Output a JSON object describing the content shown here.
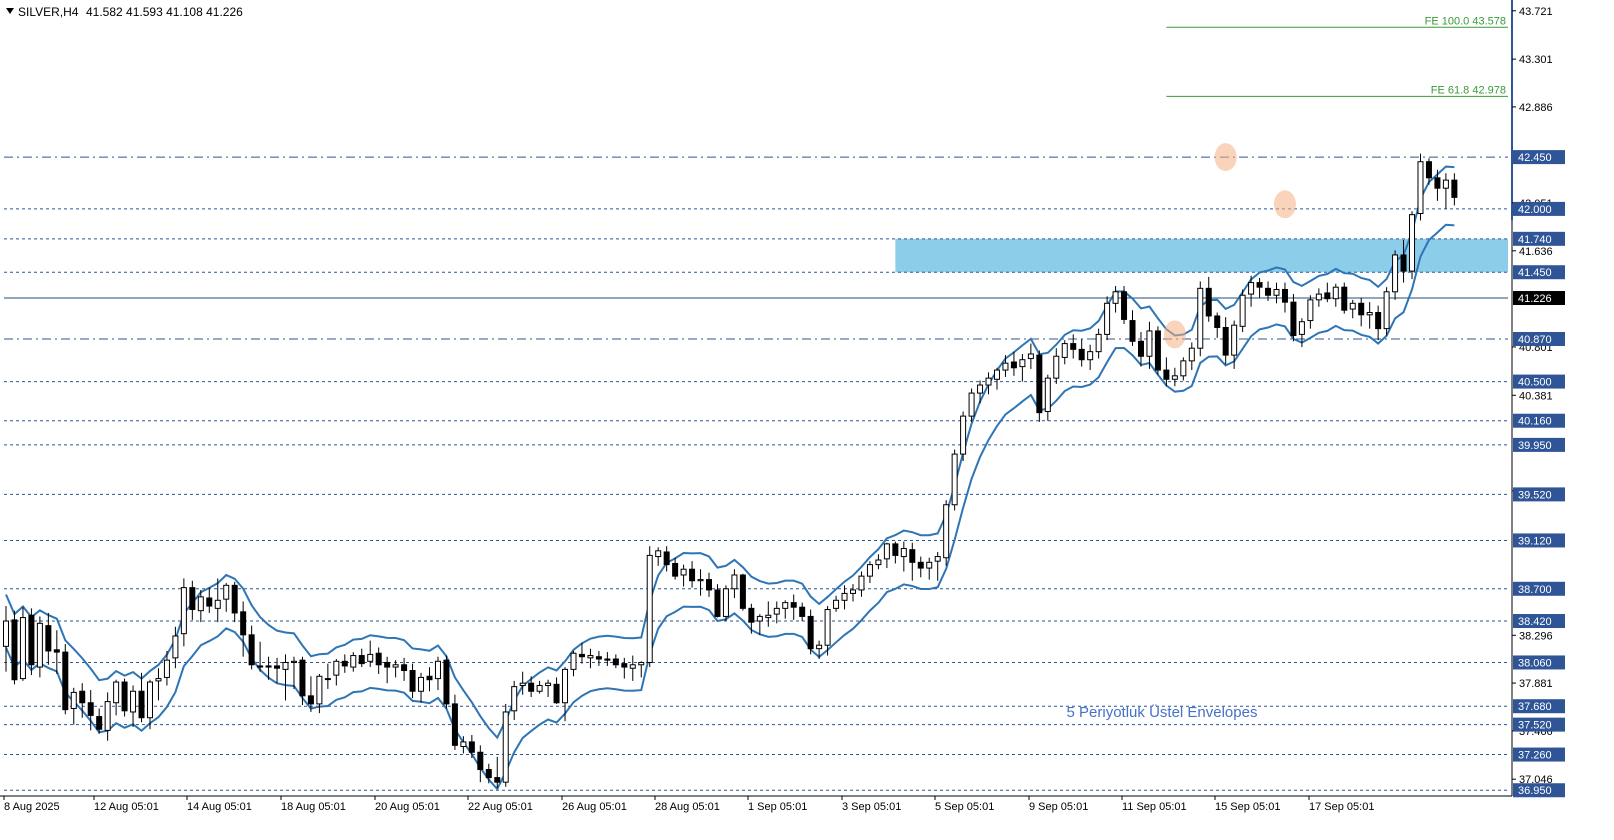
{
  "header": {
    "symbol": "SILVER,H4",
    "ohlc": "41.582 41.593 41.108 41.226"
  },
  "annotation": "5 Periyotluk Üstel Envelopes",
  "colors": {
    "band": "#2e75b6",
    "hline": "#2f5597",
    "zone": "#7fc8e8",
    "fib": "#3a9a3a",
    "fib_text": "#3a9a3a",
    "label_bg": "#2f5597",
    "highlight": "#f4b183",
    "annotation": "#4472c4"
  },
  "chart_data": {
    "type": "candlestick",
    "ylim": [
      36.9,
      43.78
    ],
    "x_tick_labels": [
      "8 Aug 2025",
      "12 Aug 05:01",
      "14 Aug 05:01",
      "18 Aug 05:01",
      "20 Aug 05:01",
      "22 Aug 05:01",
      "26 Aug 05:01",
      "28 Aug 05:01",
      "1 Sep 05:01",
      "3 Sep 05:01",
      "5 Sep 05:01",
      "9 Sep 05:01",
      "11 Sep 05:01",
      "15 Sep 05:01",
      "17 Sep 05:01"
    ],
    "y_tick_labels": [
      "43.721",
      "43.301",
      "42.886",
      "42.051",
      "41.636",
      "40.801",
      "40.381",
      "39.551",
      "38.296",
      "37.881",
      "37.466",
      "37.046"
    ],
    "horizontal_levels": [
      {
        "label": "42.450",
        "value": 42.45,
        "style": "dashdot"
      },
      {
        "label": "42.000",
        "value": 42.0,
        "style": "dashed"
      },
      {
        "label": "41.740",
        "value": 41.74,
        "style": "dashed"
      },
      {
        "label": "41.450",
        "value": 41.45,
        "style": "dashed"
      },
      {
        "label": "40.870",
        "value": 40.87,
        "style": "dashdot"
      },
      {
        "label": "40.500",
        "value": 40.5,
        "style": "dashed"
      },
      {
        "label": "40.160",
        "value": 40.16,
        "style": "dashed"
      },
      {
        "label": "39.950",
        "value": 39.95,
        "style": "dashed"
      },
      {
        "label": "39.520",
        "value": 39.52,
        "style": "dashed"
      },
      {
        "label": "39.120",
        "value": 39.12,
        "style": "dashed"
      },
      {
        "label": "38.700",
        "value": 38.7,
        "style": "dashed"
      },
      {
        "label": "38.420",
        "value": 38.42,
        "style": "dashed"
      },
      {
        "label": "38.060",
        "value": 38.06,
        "style": "dashed"
      },
      {
        "label": "37.680",
        "value": 37.68,
        "style": "dashed"
      },
      {
        "label": "37.520",
        "value": 37.52,
        "style": "dashed"
      },
      {
        "label": "37.260",
        "value": 37.26,
        "style": "dashed"
      },
      {
        "label": "36.950",
        "value": 36.95,
        "style": "dashed"
      }
    ],
    "current_price": {
      "label": "41.226",
      "value": 41.226
    },
    "zone": {
      "from": 41.45,
      "to": 41.74,
      "start_bar": 105
    },
    "fib_levels": [
      {
        "label": "FE 100.0 43.578",
        "value": 43.578,
        "start_bar": 137
      },
      {
        "label": "FE 61.8 42.978",
        "value": 42.978,
        "start_bar": 137
      }
    ],
    "highlights": [
      {
        "bar": 144,
        "value": 42.45
      },
      {
        "bar": 151,
        "value": 42.04
      },
      {
        "bar": 138,
        "value": 40.91
      }
    ],
    "bar_count": 163,
    "candles": [
      {
        "o": 38.2,
        "h": 38.55,
        "l": 37.98,
        "c": 38.42
      },
      {
        "o": 38.43,
        "h": 38.51,
        "l": 37.87,
        "c": 37.91
      },
      {
        "o": 37.92,
        "h": 38.54,
        "l": 37.9,
        "c": 38.45
      },
      {
        "o": 38.47,
        "h": 38.53,
        "l": 37.95,
        "c": 38.04
      },
      {
        "o": 38.02,
        "h": 38.46,
        "l": 37.93,
        "c": 38.4
      },
      {
        "o": 38.38,
        "h": 38.49,
        "l": 38.04,
        "c": 38.16
      },
      {
        "o": 38.17,
        "h": 38.34,
        "l": 37.96,
        "c": 38.15
      },
      {
        "o": 38.15,
        "h": 38.22,
        "l": 37.61,
        "c": 37.65
      },
      {
        "o": 37.66,
        "h": 37.84,
        "l": 37.52,
        "c": 37.8
      },
      {
        "o": 37.81,
        "h": 37.88,
        "l": 37.58,
        "c": 37.71
      },
      {
        "o": 37.71,
        "h": 37.82,
        "l": 37.47,
        "c": 37.6
      },
      {
        "o": 37.59,
        "h": 37.66,
        "l": 37.44,
        "c": 37.48
      },
      {
        "o": 37.47,
        "h": 37.8,
        "l": 37.38,
        "c": 37.72
      },
      {
        "o": 37.71,
        "h": 37.91,
        "l": 37.6,
        "c": 37.89
      },
      {
        "o": 37.89,
        "h": 37.92,
        "l": 37.59,
        "c": 37.64
      },
      {
        "o": 37.63,
        "h": 37.86,
        "l": 37.5,
        "c": 37.81
      },
      {
        "o": 37.81,
        "h": 37.97,
        "l": 37.54,
        "c": 37.58
      },
      {
        "o": 37.58,
        "h": 37.91,
        "l": 37.48,
        "c": 37.89
      },
      {
        "o": 37.9,
        "h": 38.01,
        "l": 37.73,
        "c": 37.92
      },
      {
        "o": 37.93,
        "h": 38.16,
        "l": 37.86,
        "c": 38.08
      },
      {
        "o": 38.1,
        "h": 38.37,
        "l": 38.01,
        "c": 38.29
      },
      {
        "o": 38.31,
        "h": 38.79,
        "l": 38.2,
        "c": 38.71
      },
      {
        "o": 38.71,
        "h": 38.77,
        "l": 38.43,
        "c": 38.52
      },
      {
        "o": 38.51,
        "h": 38.69,
        "l": 38.41,
        "c": 38.63
      },
      {
        "o": 38.62,
        "h": 38.71,
        "l": 38.49,
        "c": 38.55
      },
      {
        "o": 38.53,
        "h": 38.79,
        "l": 38.41,
        "c": 38.6
      },
      {
        "o": 38.61,
        "h": 38.75,
        "l": 38.5,
        "c": 38.73
      },
      {
        "o": 38.73,
        "h": 38.76,
        "l": 38.41,
        "c": 38.49
      },
      {
        "o": 38.5,
        "h": 38.59,
        "l": 38.11,
        "c": 38.3
      },
      {
        "o": 38.3,
        "h": 38.38,
        "l": 38.0,
        "c": 38.04
      },
      {
        "o": 38.03,
        "h": 38.24,
        "l": 37.98,
        "c": 38.02
      },
      {
        "o": 38.03,
        "h": 38.11,
        "l": 37.91,
        "c": 38.02
      },
      {
        "o": 38.03,
        "h": 38.1,
        "l": 37.88,
        "c": 38.01
      },
      {
        "o": 38.0,
        "h": 38.13,
        "l": 37.73,
        "c": 38.06
      },
      {
        "o": 38.06,
        "h": 38.11,
        "l": 37.83,
        "c": 38.07
      },
      {
        "o": 38.08,
        "h": 38.11,
        "l": 37.69,
        "c": 37.77
      },
      {
        "o": 37.77,
        "h": 37.94,
        "l": 37.63,
        "c": 37.7
      },
      {
        "o": 37.7,
        "h": 37.96,
        "l": 37.62,
        "c": 37.94
      },
      {
        "o": 37.92,
        "h": 38.05,
        "l": 37.83,
        "c": 37.92
      },
      {
        "o": 37.95,
        "h": 38.09,
        "l": 37.86,
        "c": 38.07
      },
      {
        "o": 38.07,
        "h": 38.13,
        "l": 37.97,
        "c": 38.03
      },
      {
        "o": 38.02,
        "h": 38.15,
        "l": 37.98,
        "c": 38.12
      },
      {
        "o": 38.12,
        "h": 38.18,
        "l": 38.02,
        "c": 38.05
      },
      {
        "o": 38.07,
        "h": 38.25,
        "l": 38.02,
        "c": 38.13
      },
      {
        "o": 38.14,
        "h": 38.19,
        "l": 37.96,
        "c": 38.04
      },
      {
        "o": 38.06,
        "h": 38.11,
        "l": 37.88,
        "c": 38.02
      },
      {
        "o": 38.02,
        "h": 38.08,
        "l": 37.93,
        "c": 38.04
      },
      {
        "o": 38.04,
        "h": 38.1,
        "l": 37.9,
        "c": 37.99
      },
      {
        "o": 37.99,
        "h": 38.05,
        "l": 37.75,
        "c": 37.81
      },
      {
        "o": 37.81,
        "h": 37.97,
        "l": 37.71,
        "c": 37.93
      },
      {
        "o": 37.94,
        "h": 38.02,
        "l": 37.81,
        "c": 37.91
      },
      {
        "o": 37.92,
        "h": 38.11,
        "l": 37.82,
        "c": 38.07
      },
      {
        "o": 38.08,
        "h": 38.12,
        "l": 37.66,
        "c": 37.7
      },
      {
        "o": 37.7,
        "h": 37.78,
        "l": 37.3,
        "c": 37.34
      },
      {
        "o": 37.33,
        "h": 37.42,
        "l": 37.27,
        "c": 37.37
      },
      {
        "o": 37.37,
        "h": 37.43,
        "l": 37.23,
        "c": 37.28
      },
      {
        "o": 37.28,
        "h": 37.34,
        "l": 37.02,
        "c": 37.13
      },
      {
        "o": 37.13,
        "h": 37.18,
        "l": 37.01,
        "c": 37.06
      },
      {
        "o": 37.06,
        "h": 37.24,
        "l": 36.97,
        "c": 37.02
      },
      {
        "o": 37.02,
        "h": 37.7,
        "l": 36.98,
        "c": 37.63
      },
      {
        "o": 37.64,
        "h": 37.9,
        "l": 37.56,
        "c": 37.85
      },
      {
        "o": 37.86,
        "h": 37.98,
        "l": 37.78,
        "c": 37.88
      },
      {
        "o": 37.88,
        "h": 37.94,
        "l": 37.76,
        "c": 37.81
      },
      {
        "o": 37.81,
        "h": 37.9,
        "l": 37.79,
        "c": 37.86
      },
      {
        "o": 37.86,
        "h": 37.91,
        "l": 37.76,
        "c": 37.88
      },
      {
        "o": 37.87,
        "h": 37.93,
        "l": 37.7,
        "c": 37.71
      },
      {
        "o": 37.71,
        "h": 38.02,
        "l": 37.55,
        "c": 38.0
      },
      {
        "o": 38.0,
        "h": 38.16,
        "l": 37.94,
        "c": 38.14
      },
      {
        "o": 38.13,
        "h": 38.23,
        "l": 38.05,
        "c": 38.11
      },
      {
        "o": 38.1,
        "h": 38.18,
        "l": 38.01,
        "c": 38.12
      },
      {
        "o": 38.11,
        "h": 38.16,
        "l": 38.03,
        "c": 38.09
      },
      {
        "o": 38.09,
        "h": 38.15,
        "l": 38.03,
        "c": 38.08
      },
      {
        "o": 38.09,
        "h": 38.13,
        "l": 38.01,
        "c": 38.04
      },
      {
        "o": 38.05,
        "h": 38.1,
        "l": 37.92,
        "c": 38.02
      },
      {
        "o": 38.01,
        "h": 38.12,
        "l": 37.9,
        "c": 38.04
      },
      {
        "o": 38.04,
        "h": 38.07,
        "l": 37.93,
        "c": 38.06
      },
      {
        "o": 38.06,
        "h": 39.07,
        "l": 38.02,
        "c": 38.99
      },
      {
        "o": 38.98,
        "h": 39.06,
        "l": 38.9,
        "c": 39.03
      },
      {
        "o": 39.02,
        "h": 39.07,
        "l": 38.85,
        "c": 38.91
      },
      {
        "o": 38.92,
        "h": 38.97,
        "l": 38.78,
        "c": 38.81
      },
      {
        "o": 38.82,
        "h": 38.91,
        "l": 38.72,
        "c": 38.87
      },
      {
        "o": 38.87,
        "h": 38.94,
        "l": 38.71,
        "c": 38.77
      },
      {
        "o": 38.77,
        "h": 38.87,
        "l": 38.64,
        "c": 38.78
      },
      {
        "o": 38.78,
        "h": 38.84,
        "l": 38.63,
        "c": 38.69
      },
      {
        "o": 38.69,
        "h": 38.74,
        "l": 38.45,
        "c": 38.46
      },
      {
        "o": 38.46,
        "h": 38.73,
        "l": 38.42,
        "c": 38.7
      },
      {
        "o": 38.7,
        "h": 38.87,
        "l": 38.62,
        "c": 38.82
      },
      {
        "o": 38.82,
        "h": 38.83,
        "l": 38.51,
        "c": 38.53
      },
      {
        "o": 38.53,
        "h": 38.57,
        "l": 38.31,
        "c": 38.41
      },
      {
        "o": 38.42,
        "h": 38.48,
        "l": 38.3,
        "c": 38.46
      },
      {
        "o": 38.45,
        "h": 38.59,
        "l": 38.37,
        "c": 38.47
      },
      {
        "o": 38.48,
        "h": 38.59,
        "l": 38.4,
        "c": 38.53
      },
      {
        "o": 38.53,
        "h": 38.6,
        "l": 38.44,
        "c": 38.58
      },
      {
        "o": 38.58,
        "h": 38.65,
        "l": 38.43,
        "c": 38.54
      },
      {
        "o": 38.54,
        "h": 38.58,
        "l": 38.42,
        "c": 38.46
      },
      {
        "o": 38.46,
        "h": 38.52,
        "l": 38.13,
        "c": 38.18
      },
      {
        "o": 38.18,
        "h": 38.25,
        "l": 38.09,
        "c": 38.21
      },
      {
        "o": 38.21,
        "h": 38.55,
        "l": 38.12,
        "c": 38.52
      },
      {
        "o": 38.53,
        "h": 38.64,
        "l": 38.5,
        "c": 38.6
      },
      {
        "o": 38.6,
        "h": 38.73,
        "l": 38.52,
        "c": 38.66
      },
      {
        "o": 38.66,
        "h": 38.74,
        "l": 38.59,
        "c": 38.69
      },
      {
        "o": 38.69,
        "h": 38.85,
        "l": 38.63,
        "c": 38.81
      },
      {
        "o": 38.81,
        "h": 38.94,
        "l": 38.75,
        "c": 38.91
      },
      {
        "o": 38.91,
        "h": 39.0,
        "l": 38.87,
        "c": 38.95
      },
      {
        "o": 38.96,
        "h": 39.1,
        "l": 38.88,
        "c": 39.09
      },
      {
        "o": 39.09,
        "h": 39.11,
        "l": 38.92,
        "c": 38.99
      },
      {
        "o": 38.98,
        "h": 39.11,
        "l": 38.85,
        "c": 39.05
      },
      {
        "o": 39.04,
        "h": 39.1,
        "l": 38.77,
        "c": 38.93
      },
      {
        "o": 38.93,
        "h": 38.98,
        "l": 38.8,
        "c": 38.88
      },
      {
        "o": 38.88,
        "h": 38.97,
        "l": 38.78,
        "c": 38.93
      },
      {
        "o": 38.94,
        "h": 39.02,
        "l": 38.77,
        "c": 38.98
      },
      {
        "o": 38.97,
        "h": 39.47,
        "l": 38.9,
        "c": 39.43
      },
      {
        "o": 39.43,
        "h": 39.91,
        "l": 39.38,
        "c": 39.87
      },
      {
        "o": 39.87,
        "h": 40.24,
        "l": 39.81,
        "c": 40.2
      },
      {
        "o": 40.2,
        "h": 40.44,
        "l": 40.15,
        "c": 40.4
      },
      {
        "o": 40.4,
        "h": 40.51,
        "l": 40.31,
        "c": 40.47
      },
      {
        "o": 40.47,
        "h": 40.58,
        "l": 40.39,
        "c": 40.53
      },
      {
        "o": 40.52,
        "h": 40.62,
        "l": 40.43,
        "c": 40.6
      },
      {
        "o": 40.6,
        "h": 40.73,
        "l": 40.54,
        "c": 40.66
      },
      {
        "o": 40.67,
        "h": 40.76,
        "l": 40.55,
        "c": 40.62
      },
      {
        "o": 40.63,
        "h": 40.74,
        "l": 40.5,
        "c": 40.69
      },
      {
        "o": 40.7,
        "h": 40.83,
        "l": 40.61,
        "c": 40.74
      },
      {
        "o": 40.73,
        "h": 40.77,
        "l": 40.15,
        "c": 40.23
      },
      {
        "o": 40.24,
        "h": 40.56,
        "l": 40.16,
        "c": 40.53
      },
      {
        "o": 40.53,
        "h": 40.79,
        "l": 40.48,
        "c": 40.72
      },
      {
        "o": 40.71,
        "h": 40.86,
        "l": 40.65,
        "c": 40.83
      },
      {
        "o": 40.83,
        "h": 40.91,
        "l": 40.7,
        "c": 40.78
      },
      {
        "o": 40.78,
        "h": 40.87,
        "l": 40.63,
        "c": 40.69
      },
      {
        "o": 40.69,
        "h": 40.82,
        "l": 40.6,
        "c": 40.76
      },
      {
        "o": 40.76,
        "h": 40.96,
        "l": 40.7,
        "c": 40.91
      },
      {
        "o": 40.91,
        "h": 41.24,
        "l": 40.86,
        "c": 41.18
      },
      {
        "o": 41.18,
        "h": 41.33,
        "l": 41.1,
        "c": 41.28
      },
      {
        "o": 41.28,
        "h": 41.33,
        "l": 41.0,
        "c": 41.04
      },
      {
        "o": 41.03,
        "h": 41.12,
        "l": 40.81,
        "c": 40.85
      },
      {
        "o": 40.85,
        "h": 40.93,
        "l": 40.63,
        "c": 40.72
      },
      {
        "o": 40.72,
        "h": 41.02,
        "l": 40.61,
        "c": 40.94
      },
      {
        "o": 40.94,
        "h": 40.98,
        "l": 40.56,
        "c": 40.6
      },
      {
        "o": 40.6,
        "h": 40.71,
        "l": 40.46,
        "c": 40.52
      },
      {
        "o": 40.52,
        "h": 40.62,
        "l": 40.46,
        "c": 40.55
      },
      {
        "o": 40.55,
        "h": 40.71,
        "l": 40.51,
        "c": 40.68
      },
      {
        "o": 40.68,
        "h": 40.84,
        "l": 40.6,
        "c": 40.79
      },
      {
        "o": 40.79,
        "h": 41.37,
        "l": 40.72,
        "c": 41.31
      },
      {
        "o": 41.31,
        "h": 41.41,
        "l": 41.02,
        "c": 41.07
      },
      {
        "o": 41.07,
        "h": 41.1,
        "l": 40.88,
        "c": 40.97
      },
      {
        "o": 40.97,
        "h": 41.06,
        "l": 40.65,
        "c": 40.73
      },
      {
        "o": 40.73,
        "h": 41.03,
        "l": 40.61,
        "c": 40.99
      },
      {
        "o": 40.98,
        "h": 41.3,
        "l": 40.93,
        "c": 41.25
      },
      {
        "o": 41.26,
        "h": 41.42,
        "l": 41.15,
        "c": 41.36
      },
      {
        "o": 41.36,
        "h": 41.4,
        "l": 41.23,
        "c": 41.32
      },
      {
        "o": 41.31,
        "h": 41.37,
        "l": 41.2,
        "c": 41.25
      },
      {
        "o": 41.25,
        "h": 41.36,
        "l": 41.18,
        "c": 41.3
      },
      {
        "o": 41.3,
        "h": 41.36,
        "l": 41.1,
        "c": 41.19
      },
      {
        "o": 41.19,
        "h": 41.26,
        "l": 40.85,
        "c": 40.9
      },
      {
        "o": 40.91,
        "h": 41.05,
        "l": 40.8,
        "c": 41.02
      },
      {
        "o": 41.03,
        "h": 41.25,
        "l": 40.96,
        "c": 41.21
      },
      {
        "o": 41.21,
        "h": 41.31,
        "l": 41.15,
        "c": 41.26
      },
      {
        "o": 41.27,
        "h": 41.36,
        "l": 41.19,
        "c": 41.22
      },
      {
        "o": 41.22,
        "h": 41.35,
        "l": 41.15,
        "c": 41.32
      },
      {
        "o": 41.32,
        "h": 41.36,
        "l": 41.09,
        "c": 41.12
      },
      {
        "o": 41.13,
        "h": 41.21,
        "l": 41.05,
        "c": 41.18
      },
      {
        "o": 41.18,
        "h": 41.23,
        "l": 40.98,
        "c": 41.08
      },
      {
        "o": 41.08,
        "h": 41.19,
        "l": 40.96,
        "c": 41.1
      },
      {
        "o": 41.1,
        "h": 41.16,
        "l": 40.86,
        "c": 40.96
      },
      {
        "o": 40.96,
        "h": 41.32,
        "l": 40.9,
        "c": 41.28
      },
      {
        "o": 41.28,
        "h": 41.64,
        "l": 41.21,
        "c": 41.6
      },
      {
        "o": 41.6,
        "h": 41.73,
        "l": 41.36,
        "c": 41.46
      },
      {
        "o": 41.46,
        "h": 41.98,
        "l": 41.39,
        "c": 41.95
      },
      {
        "o": 41.96,
        "h": 42.48,
        "l": 41.9,
        "c": 42.41
      },
      {
        "o": 42.41,
        "h": 42.44,
        "l": 42.21,
        "c": 42.27
      },
      {
        "o": 42.27,
        "h": 42.34,
        "l": 42.07,
        "c": 42.18
      },
      {
        "o": 42.18,
        "h": 42.31,
        "l": 42.0,
        "c": 42.25
      },
      {
        "o": 42.25,
        "h": 42.31,
        "l": 42.03,
        "c": 42.1
      }
    ]
  }
}
